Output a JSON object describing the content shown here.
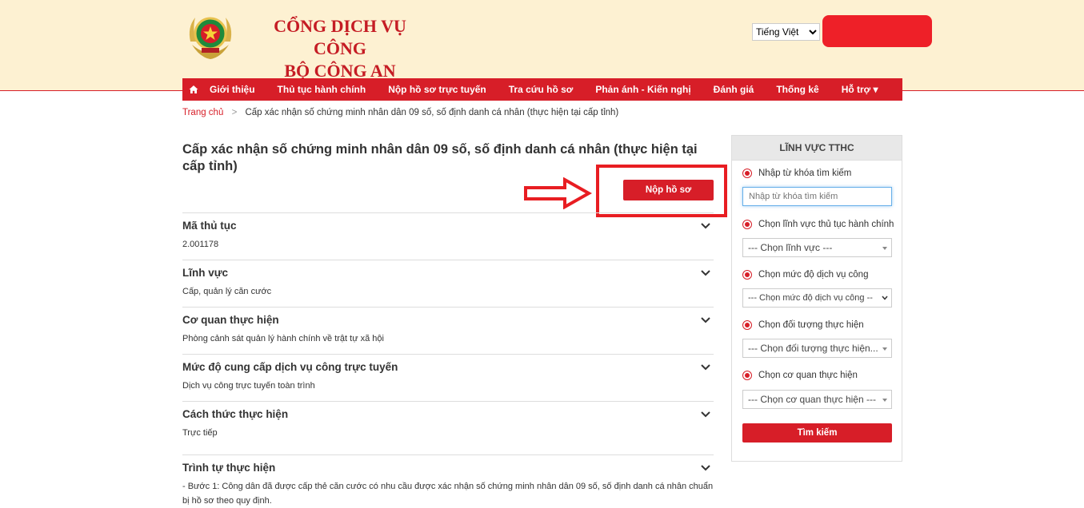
{
  "header": {
    "title_line1": "CỔNG DỊCH VỤ CÔNG",
    "title_line2": "BỘ CÔNG AN",
    "language": "Tiếng Việt"
  },
  "nav": {
    "items": [
      "Giới thiệu",
      "Thủ tục hành chính",
      "Nộp hồ sơ trực tuyến",
      "Tra cứu hồ sơ",
      "Phản ánh - Kiến nghị",
      "Đánh giá",
      "Thống kê",
      "Hỗ trợ ▾"
    ]
  },
  "breadcrumb": {
    "home": "Trang chủ",
    "separator": ">",
    "current": "Cấp xác nhận số chứng minh nhân dân 09 số, số định danh cá nhân (thực hiện tại cấp tỉnh)"
  },
  "page": {
    "title": "Cấp xác nhận số chứng minh nhân dân 09 số, số định danh cá nhân (thực hiện tại cấp tỉnh)",
    "submit_label": "Nộp hồ sơ"
  },
  "details": [
    {
      "title": "Mã thủ tục",
      "value": "2.001178"
    },
    {
      "title": "Lĩnh vực",
      "value": "Cấp, quản lý căn cước"
    },
    {
      "title": "Cơ quan thực hiện",
      "value": "Phòng cảnh sát quản lý hành chính về trật tự xã hội"
    },
    {
      "title": "Mức độ cung cấp dịch vụ công trực tuyến",
      "value": "Dịch vụ công trực tuyến toàn trình"
    },
    {
      "title": "Cách thức thực hiện",
      "value": "Trực tiếp"
    },
    {
      "title": "Trình tự thực hiện",
      "value": "- Bước 1: Công dân đã được cấp thẻ căn cước có nhu cầu được xác nhận số chứng minh nhân dân 09 số, số định danh cá nhân chuẩn bị hồ sơ theo quy định."
    }
  ],
  "sidebar": {
    "heading": "LĨNH VỰC TTHC",
    "keyword_label": "Nhập từ khóa tìm kiếm",
    "keyword_placeholder": "Nhập từ khóa tìm kiếm",
    "field_label": "Chọn lĩnh vực thủ tục hành chính",
    "field_value": "--- Chọn lĩnh vực ---",
    "level_label": "Chọn mức độ dịch vụ công",
    "level_value": "--- Chọn mức độ dịch vụ công --",
    "subject_label": "Chọn đối tượng thực hiện",
    "subject_value": "--- Chọn đối tượng thực hiện...",
    "agency_label": "Chọn cơ quan thực hiện",
    "agency_value": "--- Chọn cơ quan thực hiện ---",
    "search_label": "Tìm kiếm"
  },
  "colors": {
    "primary": "#d71e28",
    "header_bg": "#fdf1d2",
    "highlight": "#e81d22"
  }
}
